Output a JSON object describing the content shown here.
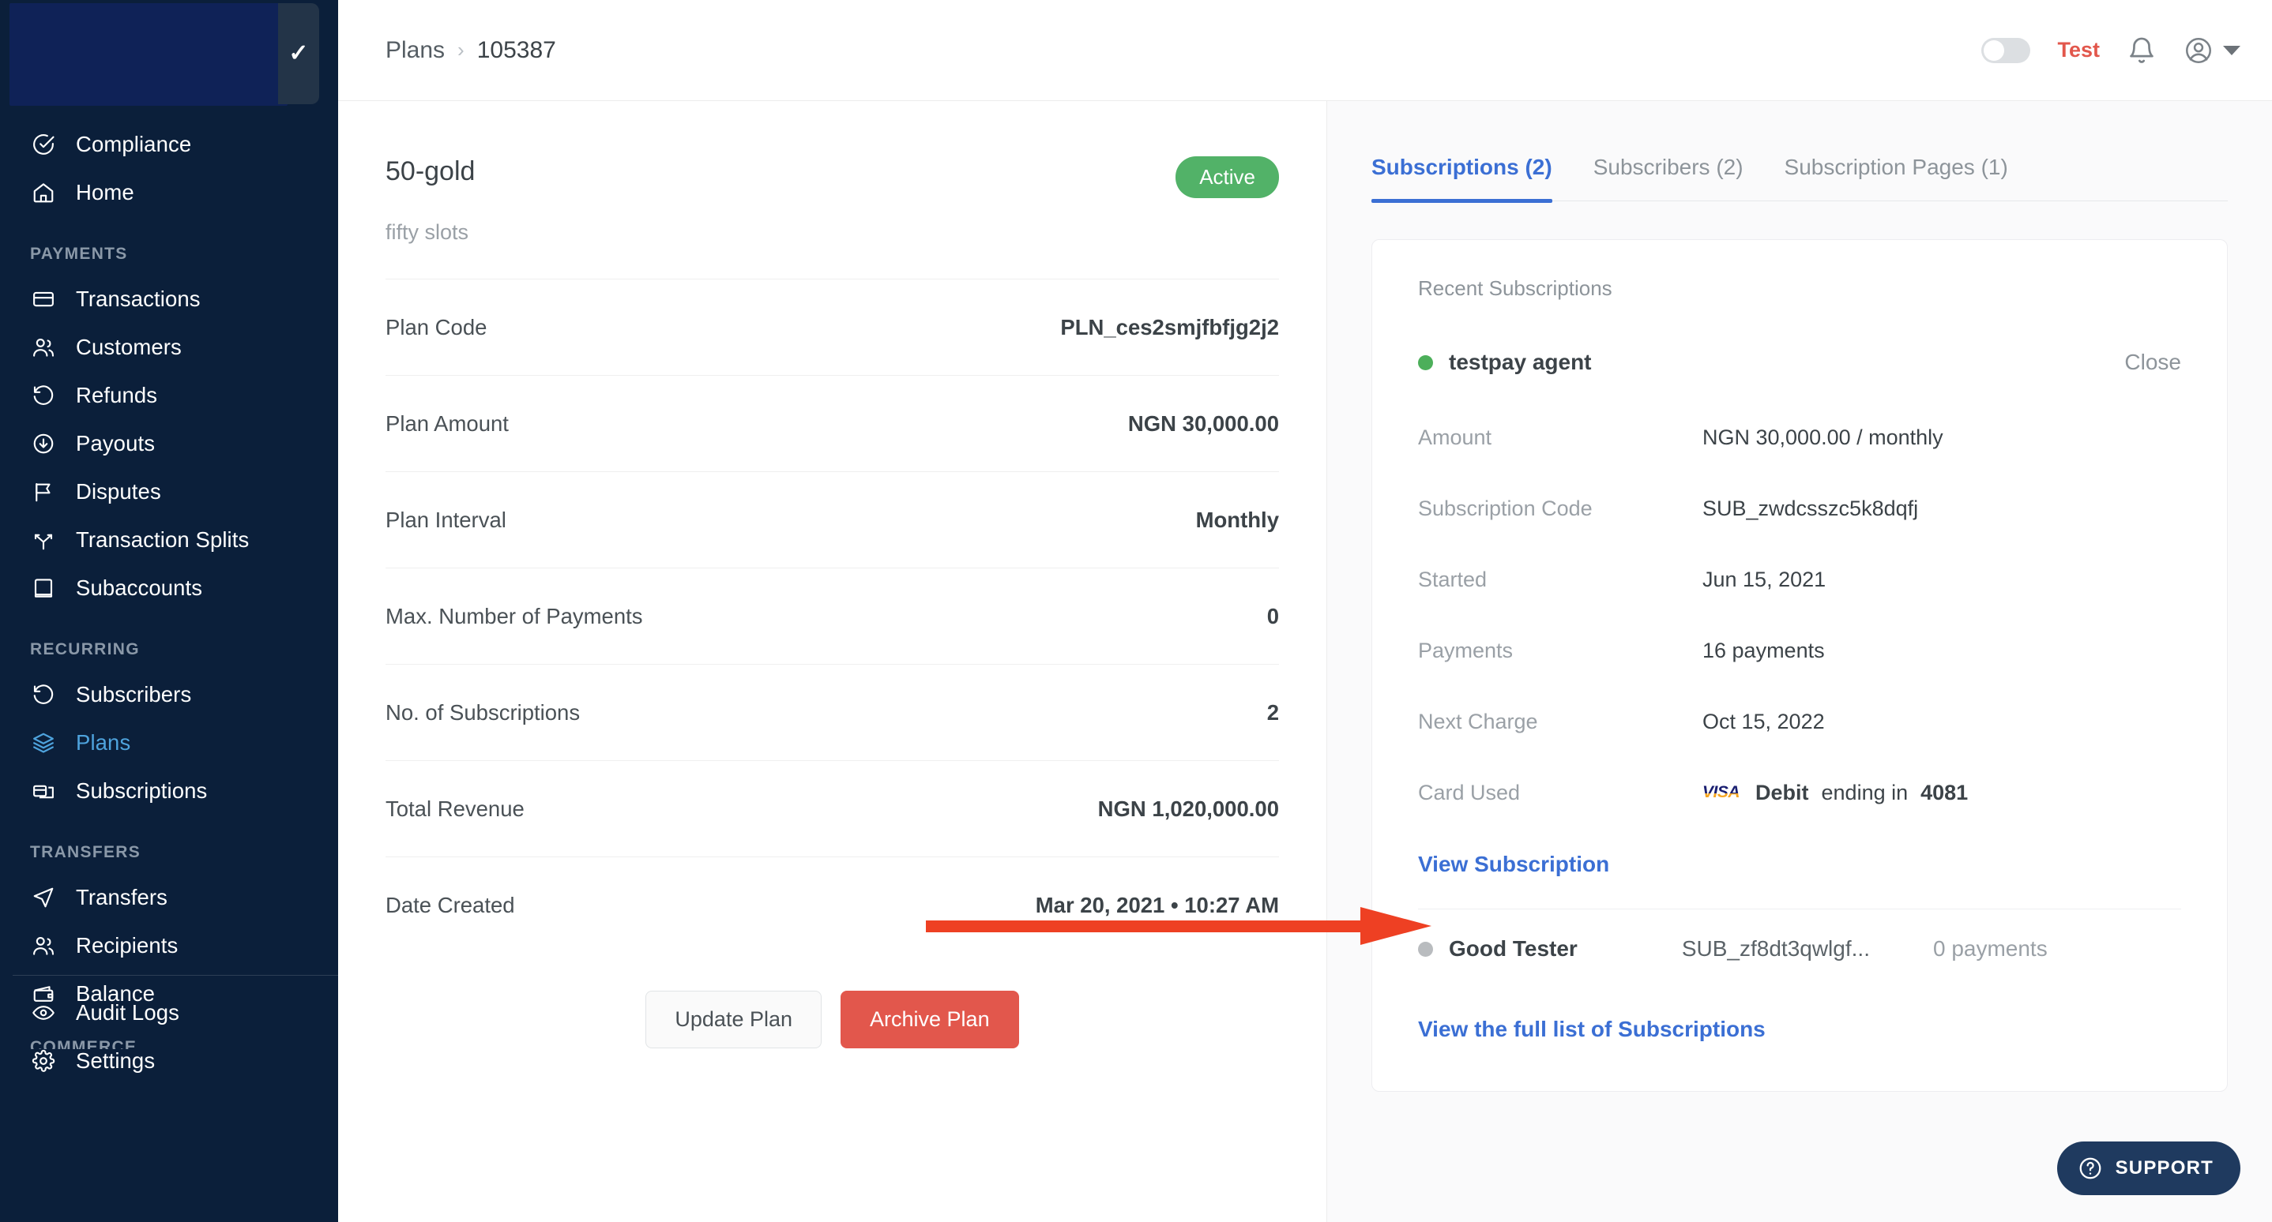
{
  "sidebar": {
    "business_switcher": {
      "checkmark": "✓"
    },
    "top_items": [
      {
        "label": "Compliance",
        "icon": "check-circle-icon",
        "active": false
      },
      {
        "label": "Home",
        "icon": "home-icon",
        "active": false
      }
    ],
    "groups": [
      {
        "title": "PAYMENTS",
        "items": [
          {
            "label": "Transactions",
            "icon": "card-icon",
            "active": false
          },
          {
            "label": "Customers",
            "icon": "users-icon",
            "active": false
          },
          {
            "label": "Refunds",
            "icon": "refund-icon",
            "active": false
          },
          {
            "label": "Payouts",
            "icon": "payout-icon",
            "active": false
          },
          {
            "label": "Disputes",
            "icon": "flag-icon",
            "active": false
          },
          {
            "label": "Transaction Splits",
            "icon": "split-icon",
            "active": false
          },
          {
            "label": "Subaccounts",
            "icon": "book-icon",
            "active": false
          }
        ]
      },
      {
        "title": "RECURRING",
        "items": [
          {
            "label": "Subscribers",
            "icon": "refund-icon",
            "active": false
          },
          {
            "label": "Plans",
            "icon": "layers-icon",
            "active": true
          },
          {
            "label": "Subscriptions",
            "icon": "cards-stack-icon",
            "active": false
          }
        ]
      },
      {
        "title": "TRANSFERS",
        "items": [
          {
            "label": "Transfers",
            "icon": "send-icon",
            "active": false
          },
          {
            "label": "Recipients",
            "icon": "users-icon",
            "active": false
          },
          {
            "label": "Balance",
            "icon": "wallet-icon",
            "active": false
          }
        ]
      },
      {
        "title": "COMMERCE",
        "items": []
      }
    ],
    "bottom_items": [
      {
        "label": "Audit Logs",
        "icon": "eye-icon",
        "active": false
      },
      {
        "label": "Settings",
        "icon": "gear-icon",
        "active": false
      }
    ]
  },
  "topbar": {
    "breadcrumb_parent": "Plans",
    "breadcrumb_separator": "›",
    "breadcrumb_current": "105387",
    "mode_label": "Test",
    "mode_enabled": false,
    "notification_icon": "bell-icon",
    "avatar_icon": "user-circle-icon",
    "caret_icon": "chevron-down-icon"
  },
  "plan": {
    "title": "50-gold",
    "status_badge": "Active",
    "description": "fifty slots",
    "details": [
      {
        "label": "Plan Code",
        "value": "PLN_ces2smjfbfjg2j2"
      },
      {
        "label": "Plan Amount",
        "value": "NGN 30,000.00"
      },
      {
        "label": "Plan Interval",
        "value": "Monthly"
      },
      {
        "label": "Max. Number of Payments",
        "value": "0"
      },
      {
        "label": "No. of Subscriptions",
        "value": "2"
      },
      {
        "label": "Total Revenue",
        "value": "NGN 1,020,000.00"
      },
      {
        "label": "Date Created",
        "value": "Mar 20, 2021 • 10:27 AM"
      }
    ],
    "update_button": "Update Plan",
    "archive_button": "Archive Plan"
  },
  "right_panel": {
    "tabs": [
      {
        "label": "Subscriptions (2)",
        "active": true
      },
      {
        "label": "Subscribers (2)",
        "active": false
      },
      {
        "label": "Subscription Pages (1)",
        "active": false
      }
    ],
    "card_title": "Recent Subscriptions",
    "expanded_subscription": {
      "status_dot": "green",
      "name": "testpay agent",
      "close_label": "Close",
      "rows": [
        {
          "label": "Amount",
          "value": "NGN 30,000.00 / monthly"
        },
        {
          "label": "Subscription Code",
          "value": "SUB_zwdcsszc5k8dqfj"
        },
        {
          "label": "Started",
          "value": "Jun 15, 2021"
        },
        {
          "label": "Payments",
          "value": "16 payments"
        },
        {
          "label": "Next Charge",
          "value": "Oct 15, 2022"
        }
      ],
      "card_used_label": "Card Used",
      "card_brand": "VISA",
      "card_type": "Debit",
      "card_middle": "ending in",
      "card_last4": "4081",
      "view_link": "View Subscription"
    },
    "other_subscriptions": [
      {
        "status_dot": "grey",
        "name": "Good Tester",
        "code": "SUB_zf8dt3qwlgf...",
        "payments": "0 payments"
      }
    ],
    "full_list_link": "View the full list of Subscriptions"
  },
  "support_widget": {
    "label": "SUPPORT",
    "icon": "question-circle-icon"
  },
  "annotation": {
    "type": "red-arrow",
    "color": "#ee4023",
    "points_to": "View Subscription"
  }
}
